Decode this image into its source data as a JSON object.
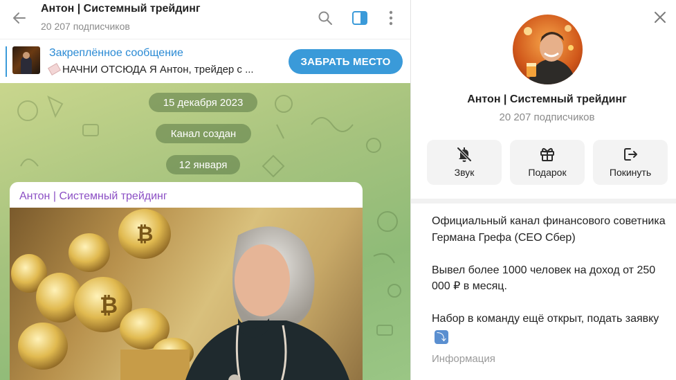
{
  "chat": {
    "title": "Антон | Системный трейдинг",
    "subscribers": "20 207 подписчиков",
    "pinned": {
      "title": "Закреплённое сообщение",
      "text": "НАЧНИ ОТСЮДА  Я Антон, трейдер с ..."
    },
    "join_button": "ЗАБРАТЬ МЕСТО",
    "service_messages": [
      "15 декабря 2023",
      "Канал создан",
      "12 января"
    ],
    "message": {
      "author": "Антон | Системный трейдинг"
    }
  },
  "icons": {
    "back": "arrow-left-icon",
    "search": "search-icon",
    "sidebar": "sidebar-toggle-icon",
    "more": "more-vertical-icon",
    "close": "close-icon",
    "mute": "bell-off-icon",
    "gift": "gift-icon",
    "leave": "logout-icon"
  },
  "profile": {
    "name": "Антон | Системный трейдинг",
    "subscribers": "20 207 подписчиков",
    "actions": [
      "Звук",
      "Подарок",
      "Покинуть"
    ],
    "description": "Официальный канал финансового советника Германа Грефа (CEO Сбер)\n\nВывел более 1000 человек на доход от 250 000 ₽ в месяц.\n\nНабор в команду ещё открыт, подать заявку",
    "description_label": "Информация"
  },
  "colors": {
    "accent": "#3a9ad9",
    "author": "#8b4fc4",
    "chat_bg": "#a6c37e"
  }
}
